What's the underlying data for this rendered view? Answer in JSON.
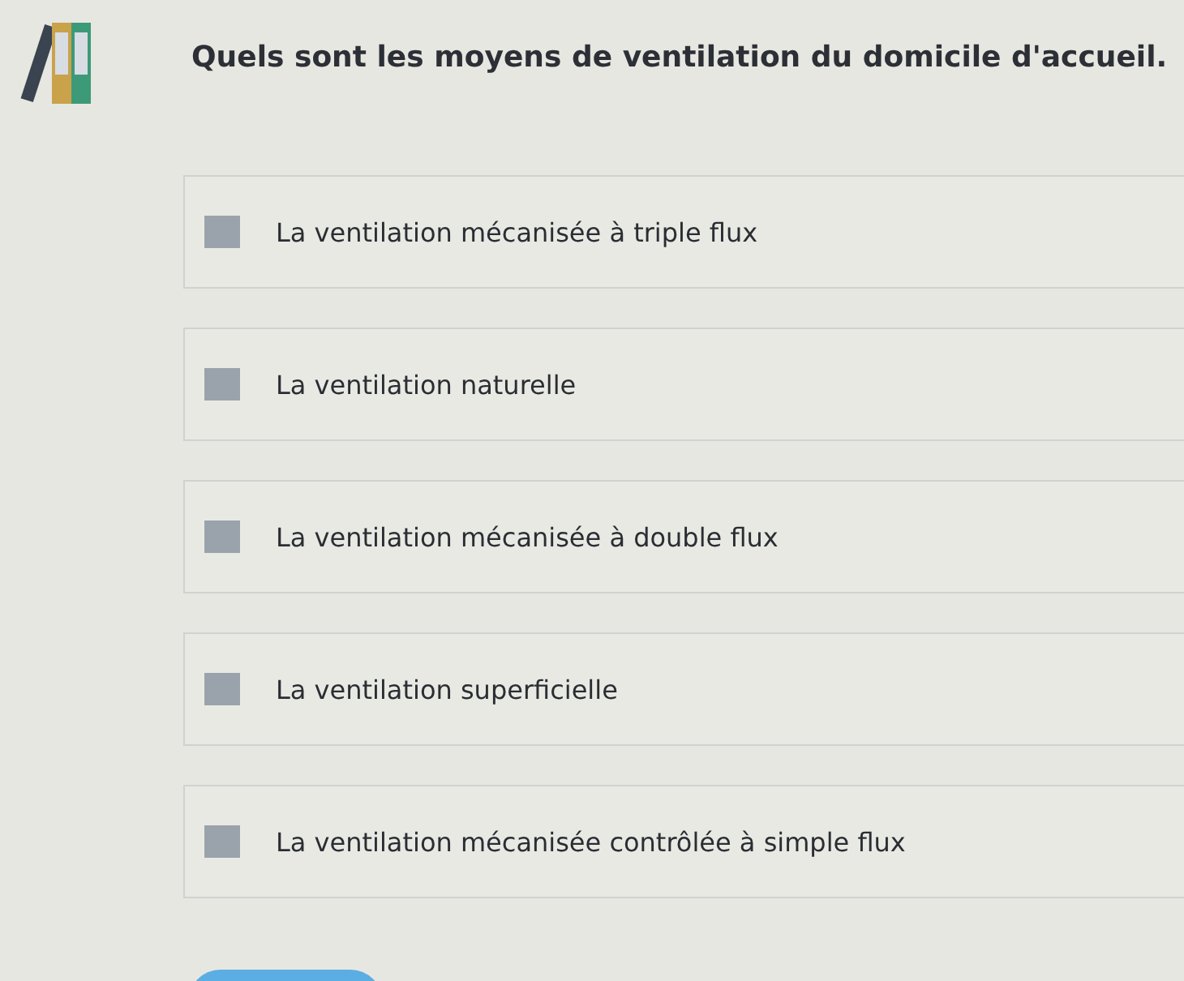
{
  "question": "Quels sont les moyens de ventilation du domicile d'accueil.",
  "options": [
    {
      "label": "La ventilation mécanisée à triple flux",
      "checked": false
    },
    {
      "label": "La ventilation naturelle",
      "checked": false
    },
    {
      "label": "La ventilation mécanisée à double flux",
      "checked": false
    },
    {
      "label": "La ventilation superficielle",
      "checked": false
    },
    {
      "label": "La ventilation mécanisée contrôlée à simple flux",
      "checked": false
    }
  ]
}
